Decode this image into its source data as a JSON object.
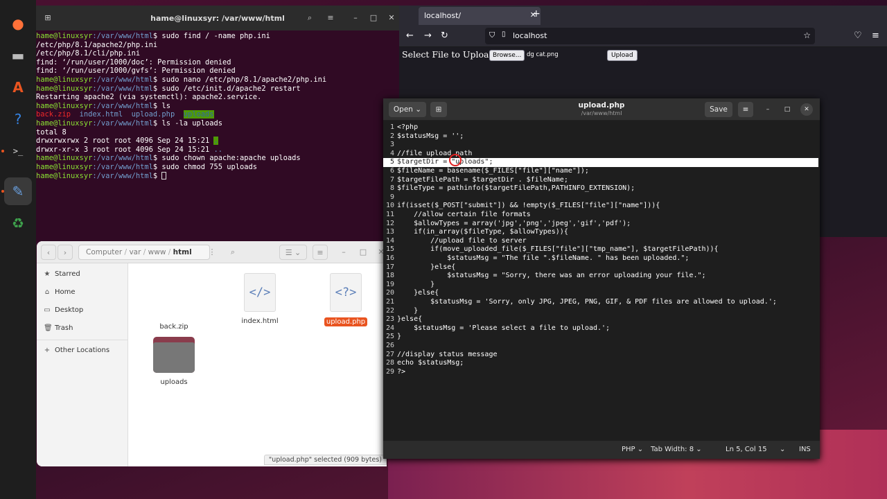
{
  "terminal": {
    "title": "hame@linuxsyr: /var/www/html",
    "lines": [
      {
        "prompt": true,
        "cmd": "sudo find / -name php.ini"
      },
      {
        "prompt": false,
        "text": "/etc/php/8.1/apache2/php.ini"
      },
      {
        "prompt": false,
        "text": "/etc/php/8.1/cli/php.ini"
      },
      {
        "prompt": false,
        "text": "find: ‘/run/user/1000/doc’: Permission denied"
      },
      {
        "prompt": false,
        "text": "find: ‘/run/user/1000/gvfs’: Permission denied"
      },
      {
        "prompt": true,
        "cmd": "sudo nano /etc/php/8.1/apache2/php.ini"
      },
      {
        "prompt": true,
        "cmd": "sudo /etc/init.d/apache2 restart"
      },
      {
        "prompt": false,
        "text": "Restarting apache2 (via systemctl): apache2.service."
      },
      {
        "prompt": true,
        "cmd": "ls"
      },
      {
        "prompt": false,
        "ls": [
          "back.zip",
          "index.html",
          "upload.php",
          "uploads"
        ]
      },
      {
        "prompt": true,
        "cmd": "ls -la uploads"
      },
      {
        "prompt": false,
        "text": "total 8"
      },
      {
        "prompt": false,
        "text": "drwxrwxrwx 2 root root 4096 Sep 24 15:21 ",
        "tail": "."
      },
      {
        "prompt": false,
        "text": "drwxr-xr-x 3 root root 4096 Sep 24 15:21 ",
        "tail2": ".."
      },
      {
        "prompt": true,
        "cmd": "sudo chown apache:apache uploads"
      },
      {
        "prompt": true,
        "cmd": "sudo chmod 755 uploads"
      },
      {
        "prompt": true,
        "cmd": "",
        "cursor": true
      }
    ],
    "prompt_user": "hame@linuxsyr",
    "prompt_path": ":/var/www/html",
    "prompt_end": "$ "
  },
  "browser": {
    "tab_title": "localhost/",
    "url": "localhost",
    "page_label": "Select File to Upload:",
    "browse_label": "Browse...",
    "file_name": "dg cat.png",
    "upload_label": "Upload"
  },
  "files": {
    "path": [
      "Computer",
      "var",
      "www",
      "html"
    ],
    "sidebar": [
      {
        "icon": "★",
        "label": "Starred"
      },
      {
        "icon": "⌂",
        "label": "Home"
      },
      {
        "icon": "▭",
        "label": "Desktop"
      },
      {
        "icon": "🗑",
        "label": "Trash"
      },
      {
        "icon": "+",
        "label": "Other Locations"
      }
    ],
    "items": [
      {
        "name": "back.zip",
        "kind": "zip"
      },
      {
        "name": "index.html",
        "kind": "html",
        "glyph": "</>"
      },
      {
        "name": "upload.php",
        "kind": "php",
        "glyph": "<?>",
        "selected": true
      },
      {
        "name": "uploads",
        "kind": "folder"
      }
    ],
    "status": "\"upload.php\" selected  (909 bytes)"
  },
  "editor": {
    "open_label": "Open",
    "save_label": "Save",
    "title": "upload.php",
    "subtitle": "/var/www/html",
    "lines": [
      "<?php",
      "$statusMsg = '';",
      "",
      "//file upload path",
      "$targetDir = \"uploads\";",
      "$fileName = basename($_FILES[\"file\"][\"name\"]);",
      "$targetFilePath = $targetDir . $fileName;",
      "$fileType = pathinfo($targetFilePath,PATHINFO_EXTENSION);",
      "",
      "if(isset($_POST[\"submit\"]) && !empty($_FILES[\"file\"][\"name\"])){",
      "    //allow certain file formats",
      "    $allowTypes = array('jpg','png','jpeg','gif','pdf');",
      "    if(in_array($fileType, $allowTypes)){",
      "        //upload file to server",
      "        if(move_uploaded_file($_FILES[\"file\"][\"tmp_name\"], $targetFilePath)){",
      "            $statusMsg = \"The file \".$fileName. \" has been uploaded.\";",
      "        }else{",
      "            $statusMsg = \"Sorry, there was an error uploading your file.\";",
      "        }",
      "    }else{",
      "        $statusMsg = 'Sorry, only JPG, JPEG, PNG, GIF, & PDF files are allowed to upload.';",
      "    }",
      "}else{",
      "    $statusMsg = 'Please select a file to upload.';",
      "}",
      "",
      "//display status message",
      "echo $statusMsg;",
      "?>"
    ],
    "current_line": 5,
    "language": "PHP",
    "tab_width": "Tab Width: 8",
    "position": "Ln 5, Col 15",
    "mode": "INS"
  }
}
